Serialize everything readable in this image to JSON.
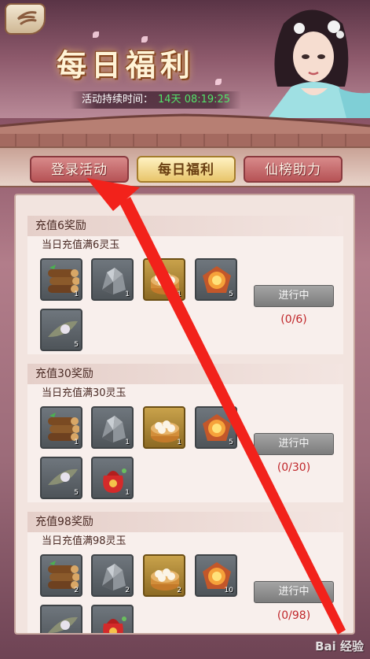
{
  "header": {
    "title": "每日福利",
    "duration_label": "活动持续时间：",
    "duration_value": "14天 08:19:25"
  },
  "tabs": [
    {
      "label": "登录活动",
      "state": "inactive"
    },
    {
      "label": "每日福利",
      "state": "active"
    },
    {
      "label": "仙榜助力",
      "state": "inactive"
    }
  ],
  "rewards": [
    {
      "title": "充值6奖励",
      "condition": "当日充值满6灵玉",
      "items": [
        {
          "icon": "wood-logs-icon",
          "count": "1"
        },
        {
          "icon": "ore-stone-icon",
          "count": "1"
        },
        {
          "icon": "steamed-buns-icon",
          "count": "1"
        },
        {
          "icon": "fire-crystal-icon",
          "count": "5"
        },
        {
          "icon": "pearl-leaf-icon",
          "count": "5"
        }
      ],
      "button": "进行中",
      "progress": "(0/6)"
    },
    {
      "title": "充值30奖励",
      "condition": "当日充值满30灵玉",
      "items": [
        {
          "icon": "wood-logs-icon",
          "count": "1"
        },
        {
          "icon": "ore-stone-icon",
          "count": "1"
        },
        {
          "icon": "steamed-buns-icon",
          "count": "1"
        },
        {
          "icon": "fire-crystal-icon",
          "count": "5"
        },
        {
          "icon": "pearl-leaf-icon",
          "count": "5"
        },
        {
          "icon": "lucky-bag-icon",
          "count": "1"
        }
      ],
      "button": "进行中",
      "progress": "(0/30)"
    },
    {
      "title": "充值98奖励",
      "condition": "当日充值满98灵玉",
      "items": [
        {
          "icon": "wood-logs-icon",
          "count": "2"
        },
        {
          "icon": "ore-stone-icon",
          "count": "2"
        },
        {
          "icon": "steamed-buns-icon",
          "count": "2"
        },
        {
          "icon": "fire-crystal-icon",
          "count": "10"
        },
        {
          "icon": "pearl-leaf-icon",
          "count": ""
        },
        {
          "icon": "lucky-bag-icon",
          "count": ""
        }
      ],
      "button": "进行中",
      "progress": "(0/98)"
    }
  ],
  "watermark": "Bai 经验",
  "colors": {
    "progress_text": "#c0262a",
    "timer_value": "#53e36a",
    "active_tab": "#e8c56b",
    "inactive_tab": "#b65356",
    "annotation_arrow": "#f2221b"
  }
}
